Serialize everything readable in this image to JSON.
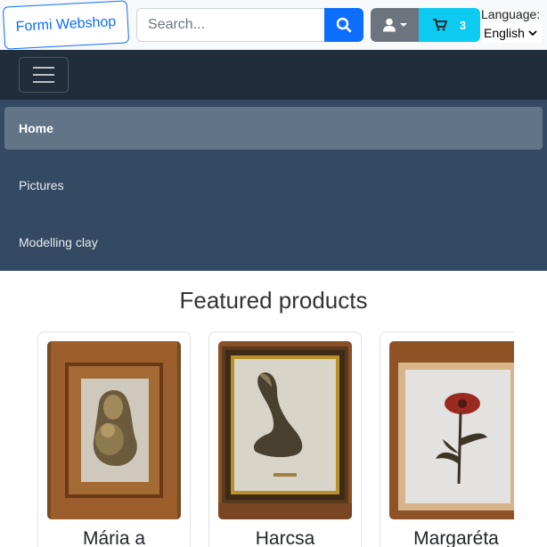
{
  "header": {
    "logo_text": "Formi Webshop",
    "search_placeholder": "Search...",
    "cart_count": "3",
    "language_label": "Language:",
    "language_selected": "English"
  },
  "nav": {
    "items": [
      {
        "label": "Home",
        "active": true
      },
      {
        "label": "Pictures",
        "active": false
      },
      {
        "label": "Modelling clay",
        "active": false
      }
    ]
  },
  "featured": {
    "title": "Featured products",
    "products": [
      {
        "title": "Mária a"
      },
      {
        "title": "Harcsa"
      },
      {
        "title": "Margaréta"
      }
    ]
  },
  "colors": {
    "primary": "#0d6efd",
    "secondary": "#6c757d",
    "info": "#0dcaf0",
    "navbar_dark": "#212d3b",
    "menu_bg": "#344a63",
    "menu_active": "#627487"
  },
  "icons": [
    "search-icon",
    "user-icon",
    "caret-down-icon",
    "cart-icon",
    "hamburger-icon",
    "chevron-down-icon"
  ]
}
